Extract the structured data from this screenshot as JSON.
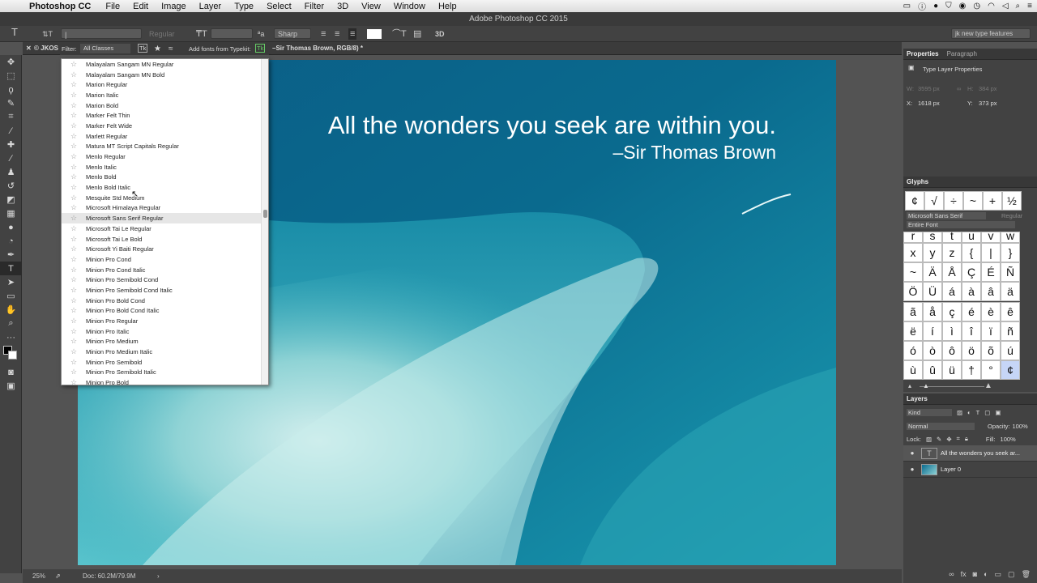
{
  "menubar": {
    "app": "Photoshop CC",
    "items": [
      "File",
      "Edit",
      "Image",
      "Layer",
      "Type",
      "Select",
      "Filter",
      "3D",
      "View",
      "Window",
      "Help"
    ]
  },
  "window_title": "Adobe Photoshop CC 2015",
  "options_bar": {
    "font_style_placeholder": "Regular",
    "antialias": "Sharp",
    "workspace": "jk new type features"
  },
  "font_panel": {
    "filter_label": "Filter:",
    "filter_value": "All Classes",
    "typekit_label": "Add fonts from Typekit:",
    "fonts": [
      "Malayalam Sangam MN Regular",
      "Malayalam Sangam MN Bold",
      "Marion Regular",
      "Marion Italic",
      "Marion Bold",
      "Marker Felt Thin",
      "Marker Felt Wide",
      "Marlett Regular",
      "Matura MT Script Capitals Regular",
      "Menlo Regular",
      "Menlo Italic",
      "Menlo Bold",
      "Menlo Bold Italic",
      "Mesquite Std Medium",
      "Microsoft Himalaya Regular",
      "Microsoft Sans Serif Regular",
      "Microsoft Tai Le Regular",
      "Microsoft Tai Le Bold",
      "Microsoft Yi Baiti Regular",
      "Minion Pro Cond",
      "Minion Pro Cond Italic",
      "Minion Pro Semibold Cond",
      "Minion Pro Semibold Cond Italic",
      "Minion Pro Bold Cond",
      "Minion Pro Bold Cond Italic",
      "Minion Pro Regular",
      "Minion Pro Italic",
      "Minion Pro Medium",
      "Minion Pro Medium Italic",
      "Minion Pro Semibold",
      "Minion Pro Semibold Italic",
      "Minion Pro Bold"
    ],
    "highlighted": "Microsoft Sans Serif Regular"
  },
  "doc_tab": {
    "left": "© JKOS",
    "right": "–Sir Thomas Brown, RGB/8) *"
  },
  "image": {
    "quote": "All the wonders you seek are within you.",
    "author": "–Sir Thomas Brown"
  },
  "status": {
    "zoom": "25%",
    "doc": "Doc: 60.2M/79.9M"
  },
  "properties": {
    "tab1": "Properties",
    "tab2": "Paragraph",
    "subtitle": "Type Layer Properties",
    "w_label": "W:",
    "w_value": "3595 px",
    "h_label": "H:",
    "h_value": "384 px",
    "x_label": "X:",
    "x_value": "1618 px",
    "y_label": "Y:",
    "y_value": "373 px"
  },
  "glyphs": {
    "title": "Glyphs",
    "recent": [
      "¢",
      "√",
      "÷",
      "~",
      "+",
      "½"
    ],
    "font": "Microsoft Sans Serif",
    "style": "Regular",
    "subset": "Entire Font",
    "grid": [
      "r",
      "s",
      "t",
      "u",
      "v",
      "w",
      "x",
      "y",
      "z",
      "{",
      "|",
      "}",
      "~",
      "Ä",
      "Å",
      "Ç",
      "É",
      "Ñ",
      "Ö",
      "Ü",
      "á",
      "à",
      "â",
      "ä",
      "ã",
      "å",
      "ç",
      "é",
      "è",
      "ê",
      "ë",
      "í",
      "ì",
      "î",
      "ï",
      "ñ",
      "ó",
      "ò",
      "ô",
      "ö",
      "õ",
      "ú",
      "ù",
      "û",
      "ü",
      "†",
      "°",
      "¢"
    ]
  },
  "layers": {
    "title": "Layers",
    "kind": "Kind",
    "blend": "Normal",
    "opacity_label": "Opacity:",
    "opacity": "100%",
    "lock_label": "Lock:",
    "fill_label": "Fill:",
    "fill": "100%",
    "items": [
      {
        "name": "All the wonders you seek ar...",
        "type": "T"
      },
      {
        "name": "Layer 0",
        "type": "img"
      }
    ]
  }
}
